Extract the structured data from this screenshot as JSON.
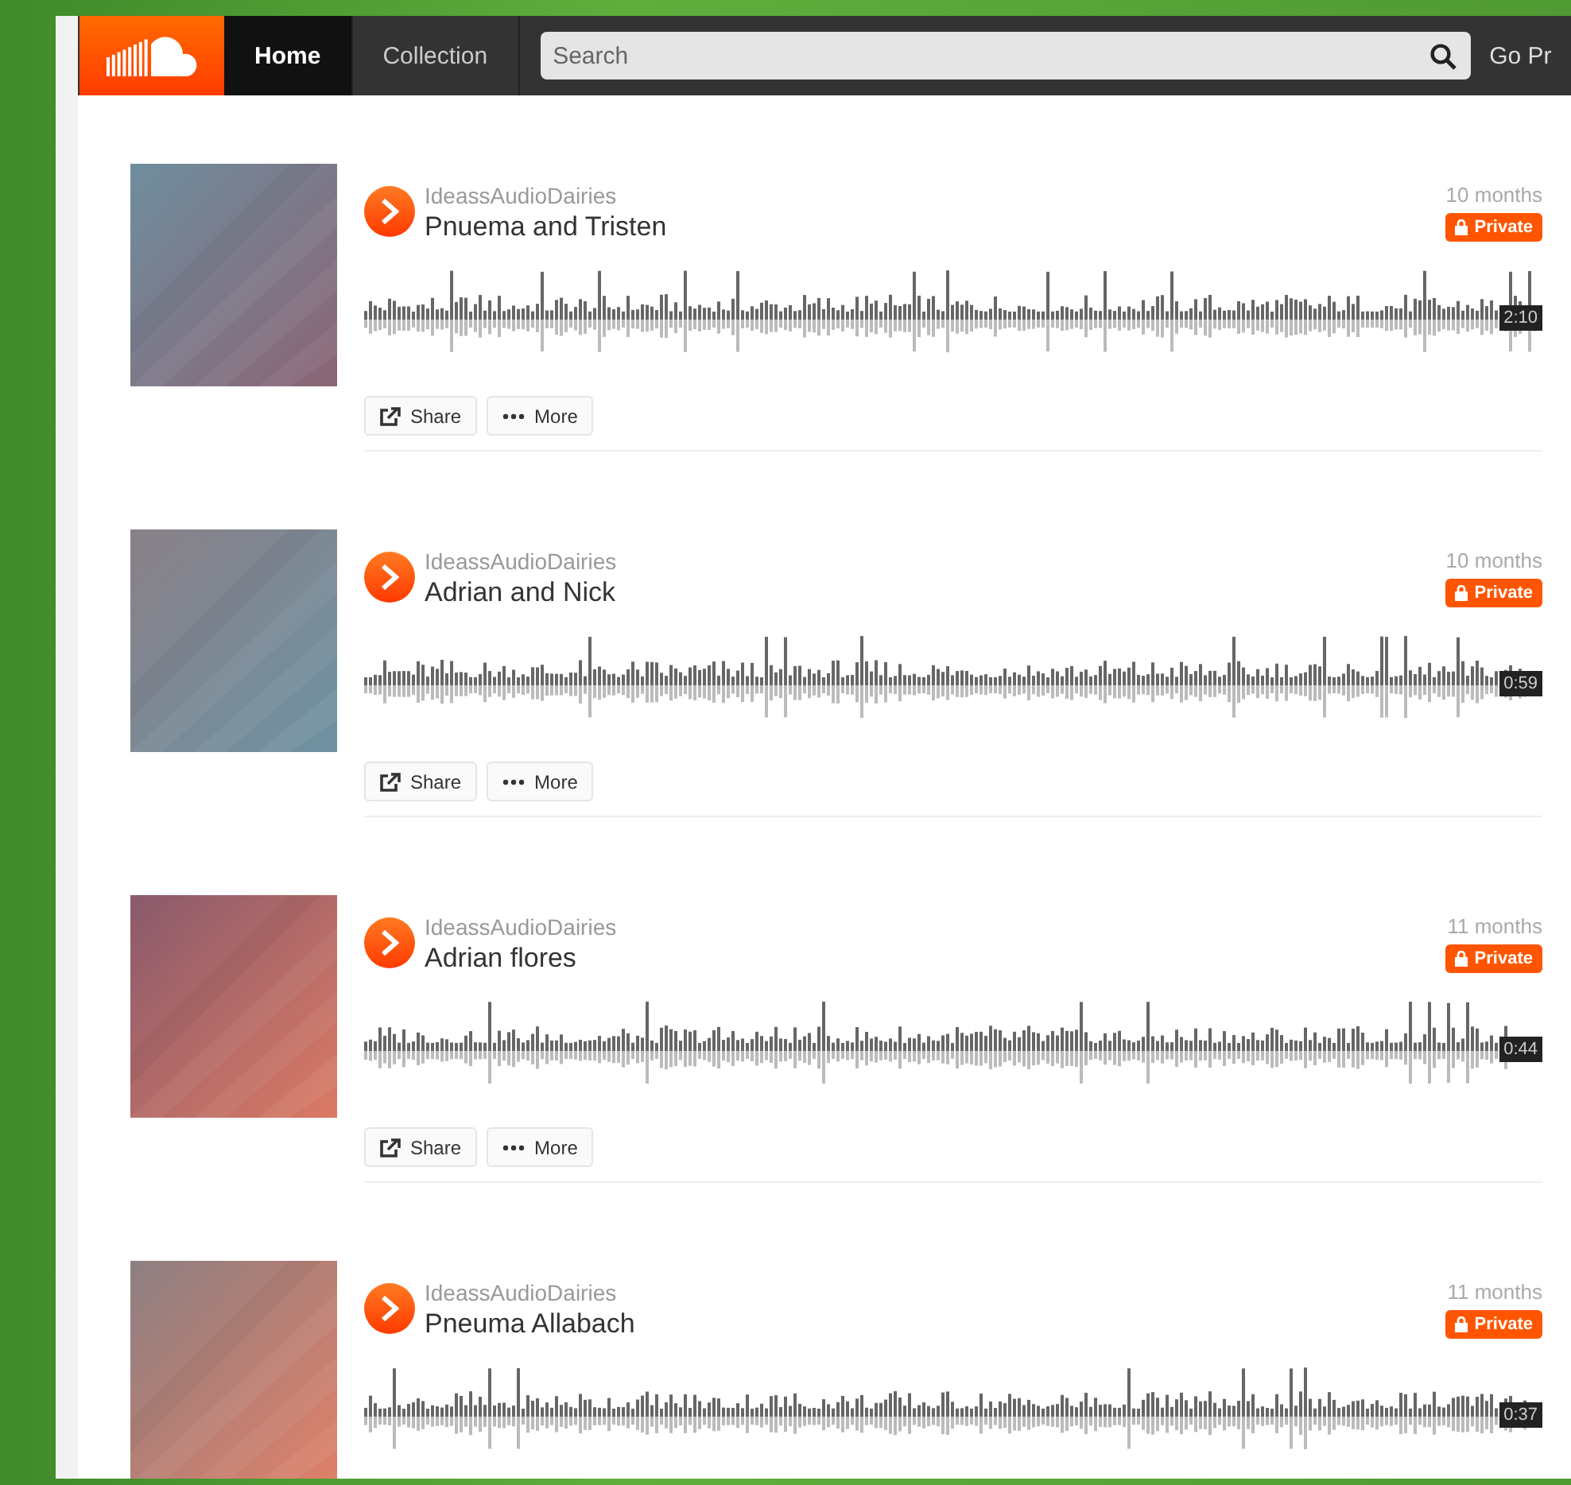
{
  "nav": {
    "tabs": [
      {
        "label": "Home",
        "selected": true
      },
      {
        "label": "Collection",
        "selected": false
      }
    ],
    "search": {
      "placeholder": "Search"
    },
    "go_pro": "Go Pr"
  },
  "tracks": [
    {
      "user": "IdeassAudioDairies",
      "title": "Pnuema and Tristen",
      "age": "10 months",
      "badge": "Private",
      "duration": "2:10",
      "actions": [
        "Share",
        "More"
      ]
    },
    {
      "user": "IdeassAudioDairies",
      "title": "Adrian and Nick",
      "age": "10 months",
      "badge": "Private",
      "duration": "0:59",
      "actions": [
        "Share",
        "More"
      ]
    },
    {
      "user": "IdeassAudioDairies",
      "title": "Adrian flores",
      "age": "11 months",
      "badge": "Private",
      "duration": "0:44",
      "actions": [
        "Share",
        "More"
      ]
    },
    {
      "user": "IdeassAudioDairies",
      "title": "Pneuma Allabach",
      "age": "11 months",
      "badge": "Private",
      "duration": "0:37"
    }
  ]
}
